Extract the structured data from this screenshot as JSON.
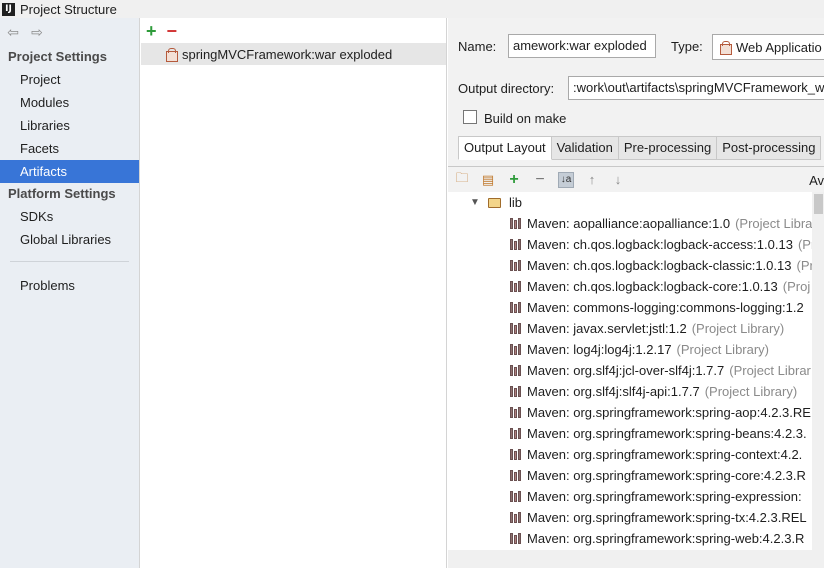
{
  "window": {
    "title": "Project Structure",
    "icon_label": "IJ"
  },
  "sidebar": {
    "sections": [
      {
        "header": "Project Settings",
        "items": [
          "Project",
          "Modules",
          "Libraries",
          "Facets",
          "Artifacts"
        ]
      },
      {
        "header": "Platform Settings",
        "items": [
          "SDKs",
          "Global Libraries"
        ]
      }
    ],
    "selected": "Artifacts",
    "problems": "Problems"
  },
  "artifacts": {
    "list": [
      "springMVCFramework:war exploded"
    ]
  },
  "detail": {
    "name_label": "Name:",
    "name_value": "amework:war exploded",
    "type_label": "Type:",
    "type_value": "Web Applicatio",
    "output_label": "Output directory:",
    "output_value": ":work\\out\\artifacts\\springMVCFramework_w",
    "build_label": "Build on make",
    "tabs": [
      "Output Layout",
      "Validation",
      "Pre-processing",
      "Post-processing"
    ],
    "active_tab": "Output Layout",
    "available_label": "Av"
  },
  "tree": {
    "folder": "lib",
    "items": [
      {
        "name": "Maven: aopalliance:aopalliance:1.0",
        "suffix": " (Project Libra"
      },
      {
        "name": "Maven: ch.qos.logback:logback-access:1.0.13",
        "suffix": " (Pr"
      },
      {
        "name": "Maven: ch.qos.logback:logback-classic:1.0.13",
        "suffix": " (Pr"
      },
      {
        "name": "Maven: ch.qos.logback:logback-core:1.0.13",
        "suffix": " (Proj"
      },
      {
        "name": "Maven: commons-logging:commons-logging:1.2",
        "suffix": ""
      },
      {
        "name": "Maven: javax.servlet:jstl:1.2",
        "suffix": " (Project Library)"
      },
      {
        "name": "Maven: log4j:log4j:1.2.17",
        "suffix": " (Project Library)"
      },
      {
        "name": "Maven: org.slf4j:jcl-over-slf4j:1.7.7",
        "suffix": " (Project Librar"
      },
      {
        "name": "Maven: org.slf4j:slf4j-api:1.7.7",
        "suffix": " (Project Library)"
      },
      {
        "name": "Maven: org.springframework:spring-aop:4.2.3.RE",
        "suffix": ""
      },
      {
        "name": "Maven: org.springframework:spring-beans:4.2.3.",
        "suffix": ""
      },
      {
        "name": "Maven: org.springframework:spring-context:4.2.",
        "suffix": ""
      },
      {
        "name": "Maven: org.springframework:spring-core:4.2.3.R",
        "suffix": ""
      },
      {
        "name": "Maven: org.springframework:spring-expression:",
        "suffix": ""
      },
      {
        "name": "Maven: org.springframework:spring-tx:4.2.3.REL",
        "suffix": ""
      },
      {
        "name": "Maven: org.springframework:spring-web:4.2.3.R",
        "suffix": ""
      }
    ]
  }
}
